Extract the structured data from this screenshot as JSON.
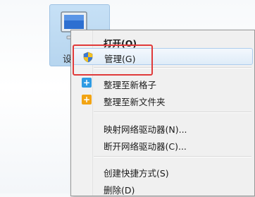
{
  "desktop": {
    "icon_label": "设",
    "icon_name": "computer-icon"
  },
  "context_menu": {
    "items": [
      {
        "label": "打开(O)",
        "bold": true
      },
      {
        "label": "管理(G)",
        "icon": "shield-icon",
        "highlighted": true
      },
      {
        "label": "整理至新格子",
        "icon": "plus-blue-icon"
      },
      {
        "label": "整理至新文件夹",
        "icon": "plus-orange-icon"
      },
      {
        "label": "映射网络驱动器(N)..."
      },
      {
        "label": "断开网络驱动器(C)..."
      },
      {
        "label": "创建快捷方式(S)"
      },
      {
        "label": "删除(D)"
      }
    ]
  },
  "colors": {
    "highlight_border": "#e03a3a",
    "plus_blue": "#2e9be3",
    "plus_orange": "#f2a413"
  }
}
